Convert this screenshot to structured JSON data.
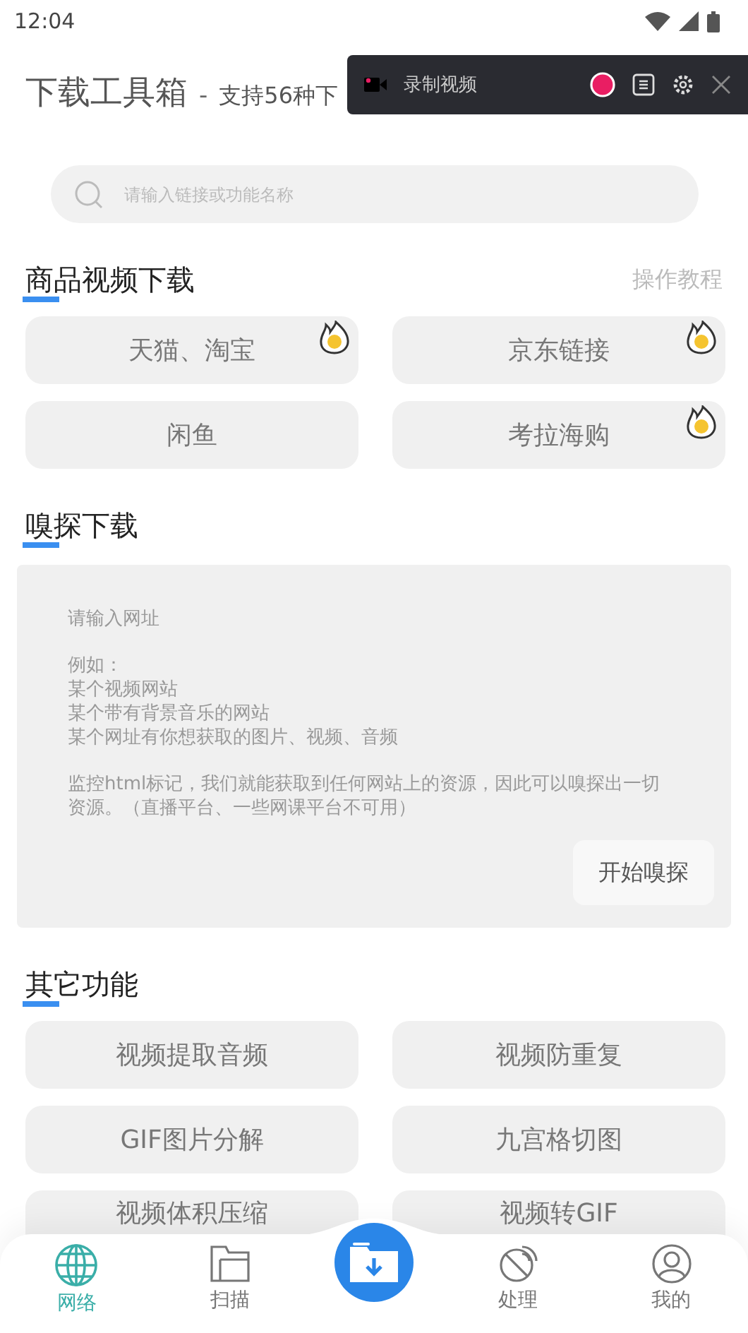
{
  "status_bar": {
    "time": "12:04"
  },
  "header": {
    "title": "下载工具箱",
    "separator": "-",
    "subtitle": "支持56种下"
  },
  "recorder": {
    "label": "录制视频"
  },
  "search": {
    "placeholder": "请输入链接或功能名称"
  },
  "product_section": {
    "title": "商品视频下载",
    "link": "操作教程",
    "items": [
      {
        "label": "天猫、淘宝",
        "hot": true
      },
      {
        "label": "京东链接",
        "hot": true
      },
      {
        "label": "闲鱼",
        "hot": false
      },
      {
        "label": "考拉海购",
        "hot": true
      }
    ]
  },
  "sniff_section": {
    "title": "嗅探下载",
    "paragraphs": [
      [
        "请输入网址"
      ],
      [
        "例如：",
        "某个视频网站",
        "某个带有背景音乐的网站",
        "某个网址有你想获取的图片、视频、音频"
      ],
      [
        "监控html标记，我们就能获取到任何网站上的资源，因此可以嗅探出一切资源。（直播平台、一些网课平台不可用）"
      ]
    ],
    "button": "开始嗅探"
  },
  "other_section": {
    "title": "其它功能",
    "items": [
      {
        "label": "视频提取音频"
      },
      {
        "label": "视频防重复"
      },
      {
        "label": "GIF图片分解"
      },
      {
        "label": "九宫格切图"
      },
      {
        "label": "视频体积压缩"
      },
      {
        "label": "视频转GIF"
      }
    ]
  },
  "bottom_nav": [
    {
      "kind": "globe",
      "label": "网络",
      "selected": true
    },
    {
      "kind": "folder",
      "label": "扫描",
      "selected": false
    },
    {
      "kind": "center"
    },
    {
      "kind": "dish",
      "label": "处理",
      "selected": false
    },
    {
      "kind": "user",
      "label": "我的",
      "selected": false
    }
  ]
}
